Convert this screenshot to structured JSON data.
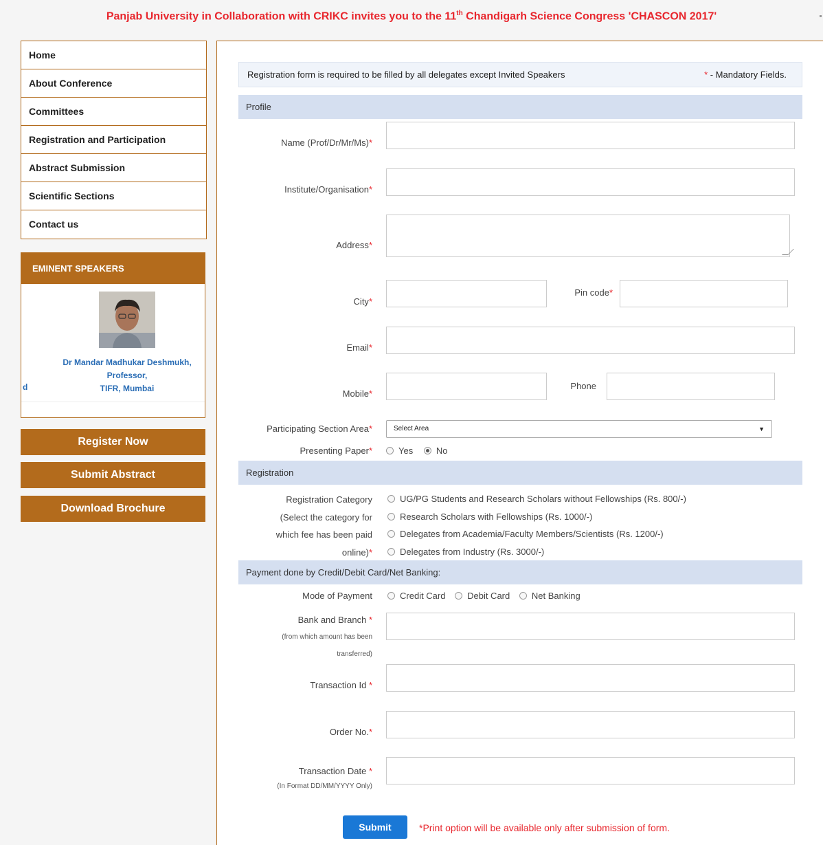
{
  "banner": {
    "pre": "Panjab University in Collaboration with CRIKC invites you to the 11",
    "sup": "th",
    "post": " Chandigarh Science Congress 'CHASCON 2017'"
  },
  "nav": [
    "Home",
    "About Conference",
    "Committees",
    "Registration and Participation",
    "Abstract Submission",
    "Scientific Sections",
    "Contact us"
  ],
  "speakers": {
    "title": "EMINENT SPEAKERS",
    "name": "Dr Mandar Madhukar Deshmukh,",
    "role": "Professor,",
    "org": "TIFR, Mumbai",
    "fragment": "d"
  },
  "buttons": {
    "register": "Register Now",
    "abstract": "Submit Abstract",
    "brochure": "Download Brochure"
  },
  "form": {
    "note": "Registration form is required to be filled by all delegates except Invited Speakers",
    "mand_star": "*",
    "mand_text": " - Mandatory Fields.",
    "section_profile": "Profile",
    "name_label": "Name (Prof/Dr/Mr/Ms)",
    "institute_label": "Institute/Organisation",
    "address_label": "Address",
    "city_label": "City",
    "pin_label": "Pin code",
    "email_label": "Email",
    "mobile_label": "Mobile",
    "phone_label": "Phone",
    "area_label": "Participating Section Area",
    "area_value": "Select Area",
    "paper_label": "Presenting Paper",
    "paper_yes": "Yes",
    "paper_no": "No",
    "section_registration": "Registration",
    "reg_cat_line1": "Registration Category",
    "reg_cat_line2": "(Select the category for",
    "reg_cat_line3": "which fee has been paid",
    "reg_cat_line4": "online)",
    "reg_options": [
      "UG/PG Students and Research Scholars without Fellowships (Rs. 800/-)",
      "Research Scholars with Fellowships (Rs. 1000/-)",
      "Delegates from Academia/Faculty Members/Scientists (Rs. 1200/-)",
      "Delegates from Industry (Rs. 3000/-)"
    ],
    "section_payment": "Payment done by Credit/Debit Card/Net Banking:",
    "mode_label": "Mode of Payment",
    "mode_options": [
      "Credit Card",
      "Debit Card",
      "Net Banking"
    ],
    "bank_label": "Bank and Branch",
    "bank_note1": "(from which amount has been",
    "bank_note2": "transferred)",
    "txn_label": "Transaction Id",
    "order_label": "Order No.",
    "date_label": "Transaction Date",
    "date_note": "(In Format DD/MM/YYYY Only)",
    "submit": "Submit",
    "print_note": "*Print option will be available only after submission of form.",
    "req": "*"
  }
}
